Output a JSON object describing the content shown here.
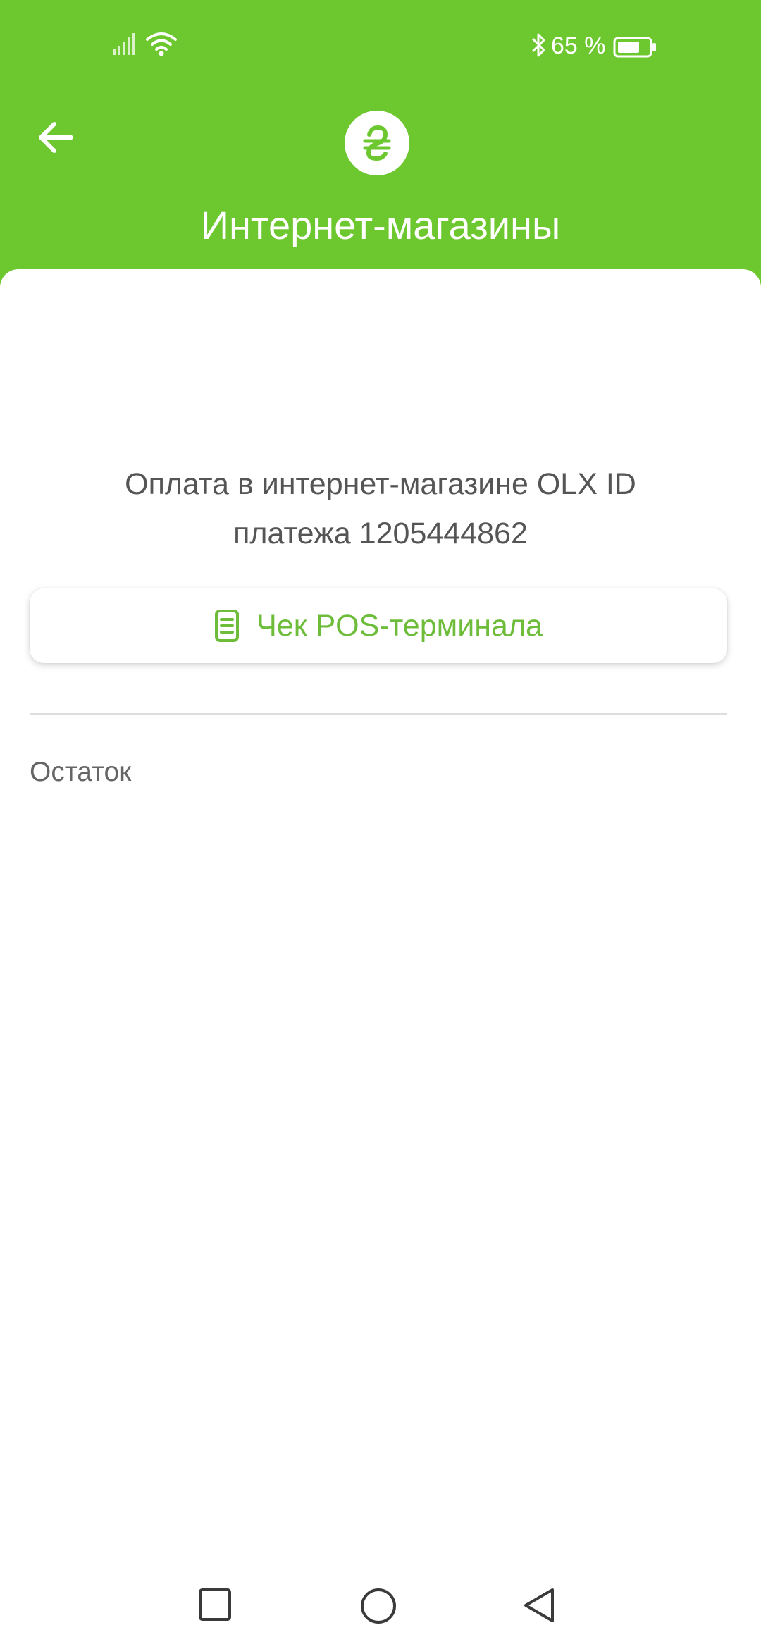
{
  "status_bar": {
    "battery_percent": "65 %",
    "icons": [
      "signal-icon",
      "wifi-icon",
      "bluetooth-icon",
      "battery-icon"
    ]
  },
  "header": {
    "title": "Интернет-магазины",
    "logo_icon": "hryvnia-icon",
    "back_icon": "arrow-left-icon",
    "background_color": "#6dc72f"
  },
  "payment": {
    "description_line1": "Оплата в интернет-магазине OLX ID",
    "description_line2": "платежа 1205444862"
  },
  "receipt_button": {
    "label": "Чек POS-терминала",
    "icon": "receipt-icon",
    "accent_color": "#6dbd3a"
  },
  "balance": {
    "label": "Остаток"
  },
  "nav_bar": {
    "icons": [
      "recent-apps-icon",
      "home-icon",
      "back-icon"
    ]
  }
}
